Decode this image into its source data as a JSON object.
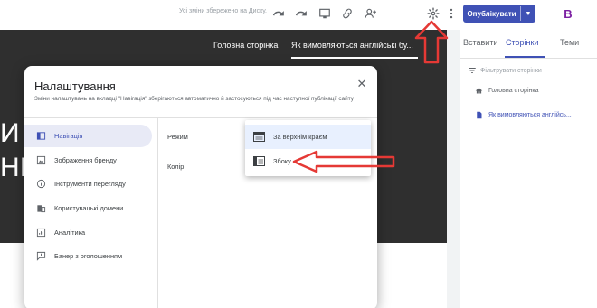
{
  "toolbar": {
    "saved_status": "Усі зміни збережено на Диску.",
    "publish_label": "Опублікувати",
    "avatar_letter": "B"
  },
  "preview": {
    "nav_links": [
      "Головна сторінка",
      "Як вимовляються англійські бу..."
    ],
    "hero_letters": [
      "И",
      "НІ"
    ]
  },
  "panel": {
    "tabs": [
      "Вставити",
      "Сторінки",
      "Теми"
    ],
    "active_tab": "Сторінки",
    "filter_placeholder": "Фільтрувати сторінки",
    "pages": [
      {
        "label": "Головна сторінка",
        "icon": "home-icon"
      },
      {
        "label": "Як вимовляються англійсь...",
        "icon": "document-icon"
      }
    ]
  },
  "dialog": {
    "title": "Налаштування",
    "subtitle": "Зміни налаштувань на вкладці \"Навігація\" зберігаються автоматично й застосуються під час наступної публікації сайту",
    "sidebar": [
      {
        "label": "Навігація",
        "icon": "navigation-icon"
      },
      {
        "label": "Зображення бренду",
        "icon": "image-icon"
      },
      {
        "label": "Інструменти перегляду",
        "icon": "info-icon"
      },
      {
        "label": "Користувацькі домени",
        "icon": "domain-icon"
      },
      {
        "label": "Аналітика",
        "icon": "analytics-icon"
      },
      {
        "label": "Банер з оголошенням",
        "icon": "announcement-icon"
      }
    ],
    "mode_label": "Режим",
    "color_label": "Колір",
    "mode_options": [
      "За верхнім краєм",
      "Збоку"
    ]
  },
  "colors": {
    "accent": "#3f51b5",
    "hero_bg": "#2f2f2f",
    "annotation": "#e53935"
  }
}
